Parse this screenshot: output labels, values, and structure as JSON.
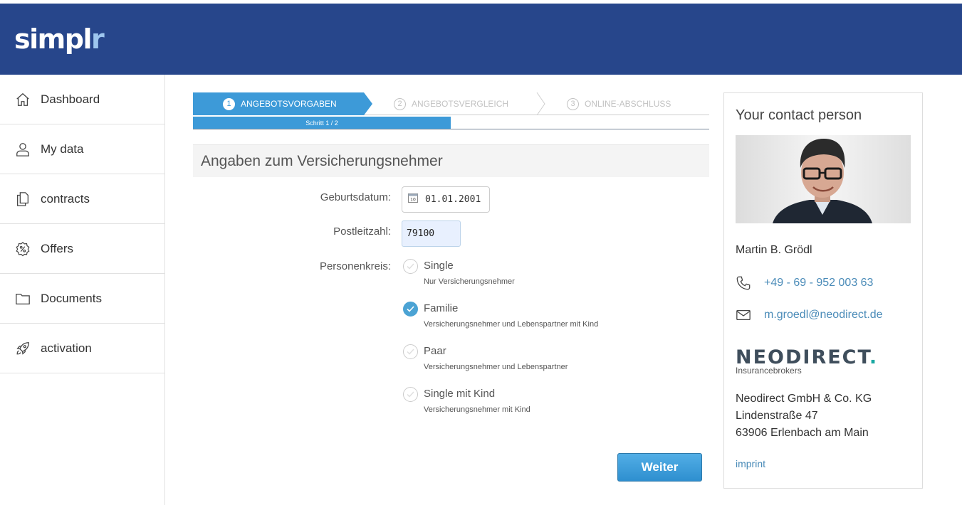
{
  "header": {
    "logo_main": "simpl",
    "logo_accent": "r"
  },
  "sidebar": {
    "items": [
      {
        "label": "Dashboard",
        "icon": "home-icon"
      },
      {
        "label": "My data",
        "icon": "user-icon"
      },
      {
        "label": "contracts",
        "icon": "documents-icon"
      },
      {
        "label": "Offers",
        "icon": "offer-badge-icon"
      },
      {
        "label": "Documents",
        "icon": "folder-icon"
      },
      {
        "label": "activation",
        "icon": "rocket-icon"
      }
    ]
  },
  "wizard": {
    "steps": [
      {
        "num": "1",
        "label": "ANGEBOTSVORGABEN",
        "active": true
      },
      {
        "num": "2",
        "label": "ANGEBOTSVERGLEICH",
        "active": false
      },
      {
        "num": "3",
        "label": "ONLINE-ABSCHLUSS",
        "active": false
      }
    ],
    "progress_text": "Schritt 1 / 2",
    "progress_fraction": 0.5
  },
  "form": {
    "section_title": "Angaben zum Versicherungsnehmer",
    "birthdate_label": "Geburtsdatum:",
    "birthdate_value": "01.01.2001",
    "calendar_day": "10",
    "zip_label": "Postleitzahl:",
    "zip_value": "79100",
    "persons_label": "Personenkreis:",
    "options": [
      {
        "title": "Single",
        "desc": "Nur Versicherungsnehmer",
        "checked": false
      },
      {
        "title": "Familie",
        "desc": "Versicherungsnehmer und Lebenspartner mit Kind",
        "checked": true
      },
      {
        "title": "Paar",
        "desc": "Versicherungsnehmer und Lebenspartner",
        "checked": false
      },
      {
        "title": "Single mit Kind",
        "desc": "Versicherungsnehmer mit Kind",
        "checked": false
      }
    ],
    "submit_label": "Weiter"
  },
  "contact": {
    "heading": "Your contact person",
    "name": "Martin B. Grödl",
    "phone": "+49 - 69 - 952 003 63",
    "email": "m.groedl@neodirect.de",
    "company_logo_text": "NEODIRECT",
    "company_logo_dot": ".",
    "company_logo_sub": "Insurancebrokers",
    "address_line1": "Neodirect GmbH & Co. KG",
    "address_line2": "Lindenstraße 47",
    "address_line3": "63906 Erlenbach am Main",
    "imprint": "imprint"
  },
  "colors": {
    "header_bg": "#27468b",
    "accent": "#3d9ad8",
    "link": "#4a8bb8",
    "logo_accent": "#9ec6ee"
  }
}
